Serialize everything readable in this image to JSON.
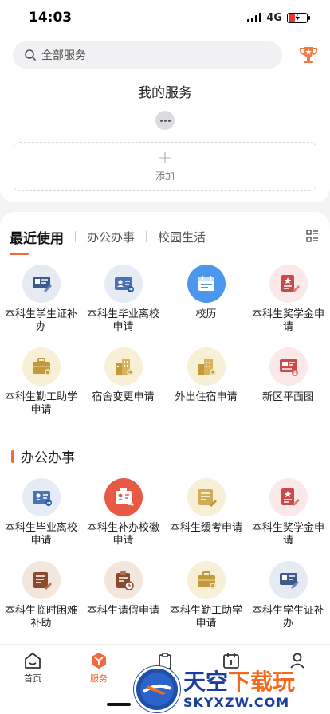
{
  "status": {
    "time": "14:03",
    "network": "4G"
  },
  "search": {
    "placeholder": "全部服务"
  },
  "my_services": {
    "title": "我的服务",
    "add_label": "添加"
  },
  "tabs": [
    {
      "label": "最近使用",
      "active": true
    },
    {
      "label": "办公办事",
      "active": false
    },
    {
      "label": "校园生活",
      "active": false
    }
  ],
  "recent": [
    {
      "label": "本科生学生证补办",
      "icon": "student-card-icon"
    },
    {
      "label": "本科生毕业离校申请",
      "icon": "id-card-icon"
    },
    {
      "label": "校历",
      "icon": "calendar-icon"
    },
    {
      "label": "本科生奖学金申请",
      "icon": "award-doc-icon"
    },
    {
      "label": "本科生勤工助学申请",
      "icon": "briefcase-icon"
    },
    {
      "label": "宿舍变更申请",
      "icon": "dormitory-icon"
    },
    {
      "label": "外出住宿申请",
      "icon": "building-icon"
    },
    {
      "label": "新区平面图",
      "icon": "map-board-icon"
    }
  ],
  "office_section": {
    "title": "办公办事"
  },
  "office": [
    {
      "label": "本科生毕业离校申请",
      "icon": "id-card-icon"
    },
    {
      "label": "本科生补办校徽申请",
      "icon": "badge-icon"
    },
    {
      "label": "本科生缓考申请",
      "icon": "exam-doc-icon"
    },
    {
      "label": "本科生奖学金申请",
      "icon": "award-doc-icon"
    },
    {
      "label": "本科生临时困难补助",
      "icon": "form-edit-icon"
    },
    {
      "label": "本科生请假申请",
      "icon": "clipboard-clock-icon"
    },
    {
      "label": "本科生勤工助学申请",
      "icon": "briefcase-icon"
    },
    {
      "label": "本科生学生证补办",
      "icon": "student-card-icon"
    }
  ],
  "nav": [
    {
      "label": "首页",
      "icon": "home-icon",
      "active": false
    },
    {
      "label": "服务",
      "icon": "service-cube-icon",
      "active": true
    },
    {
      "label": "",
      "icon": "clipboard-icon",
      "active": false
    },
    {
      "label": "",
      "icon": "calendar-icon",
      "active": false
    },
    {
      "label": "",
      "icon": "user-icon",
      "active": false
    }
  ],
  "watermark": {
    "title_blue": "天空",
    "title_orange": "下载玩",
    "url": "SKYXZW.COM"
  },
  "colors": {
    "accent": "#f06a3c",
    "brand_blue": "#1a3f9b"
  }
}
